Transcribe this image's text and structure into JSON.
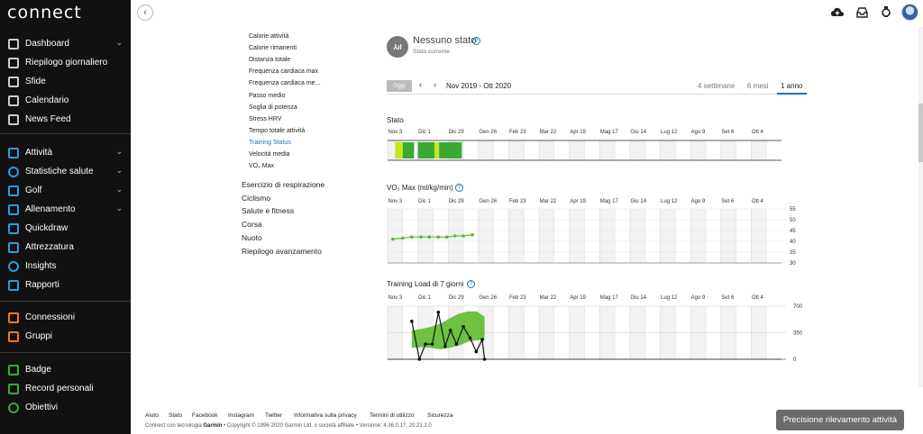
{
  "app": {
    "logo": "connect"
  },
  "sidebar": {
    "items": [
      {
        "label": "Dashboard",
        "icon": "dashboard-icon",
        "color": "#cccccc",
        "chevron": true
      },
      {
        "label": "Riepilogo giornaliero",
        "icon": "summary-icon",
        "color": "#cccccc",
        "chevron": false
      },
      {
        "label": "Sfide",
        "icon": "challenges-icon",
        "color": "#cccccc",
        "chevron": false
      },
      {
        "label": "Calendario",
        "icon": "calendar-icon",
        "color": "#cccccc",
        "chevron": false
      },
      {
        "label": "News Feed",
        "icon": "newsfeed-icon",
        "color": "#cccccc",
        "chevron": false
      },
      {
        "label": "Attività",
        "icon": "activities-icon",
        "color": "#2d9bd9",
        "chevron": true
      },
      {
        "label": "Statistiche salute",
        "icon": "heart-icon",
        "color": "#2d9bd9",
        "chevron": true
      },
      {
        "label": "Golf",
        "icon": "golf-icon",
        "color": "#2d9bd9",
        "chevron": true
      },
      {
        "label": "Allenamento",
        "icon": "training-icon",
        "color": "#2d9bd9",
        "chevron": true
      },
      {
        "label": "Quickdraw",
        "icon": "quickdraw-icon",
        "color": "#2d9bd9",
        "chevron": false
      },
      {
        "label": "Attrezzatura",
        "icon": "gear-icon",
        "color": "#2d9bd9",
        "chevron": false
      },
      {
        "label": "Insights",
        "icon": "insights-icon",
        "color": "#2d9bd9",
        "chevron": false
      },
      {
        "label": "Rapporti",
        "icon": "reports-icon",
        "color": "#2d9bd9",
        "chevron": false
      },
      {
        "label": "Connessioni",
        "icon": "connections-icon",
        "color": "#f07a1e",
        "chevron": false
      },
      {
        "label": "Gruppi",
        "icon": "groups-icon",
        "color": "#f07a1e",
        "chevron": false
      },
      {
        "label": "Badge",
        "icon": "badge-icon",
        "color": "#3aaa35",
        "chevron": false
      },
      {
        "label": "Record personali",
        "icon": "trophy-icon",
        "color": "#3aaa35",
        "chevron": false
      },
      {
        "label": "Obiettivi",
        "icon": "goals-icon",
        "color": "#3aaa35",
        "chevron": false
      }
    ]
  },
  "reports": {
    "subitems": [
      "Calorie attività",
      "Calorie rimanenti",
      "Distanza totale",
      "Frequenza cardiaca max",
      "Frequenza cardiaca me...",
      "Passo medio",
      "Soglia di potenza",
      "Stress HRV",
      "Tempo totale attività",
      "Training Status",
      "Velocità media",
      "VO₂ Max"
    ],
    "active_subitem": "Training Status",
    "categories": [
      "Esercizio di respirazione",
      "Ciclismo",
      "Salute e fitness",
      "Corsa",
      "Nuoto",
      "Riepilogo avanzamento"
    ]
  },
  "status": {
    "icon_text": "⅄ıl",
    "title": "Nessuno stato",
    "subtitle": "Stato corrente"
  },
  "date_controls": {
    "today_label": "Oggi",
    "prev": "‹",
    "next": "›",
    "range_label": "Nov 2019 - Ott 2020",
    "ranges": [
      "4 settimane",
      "6 mesi",
      "1 anno"
    ],
    "active_range": "1 anno"
  },
  "months": [
    "Nov 3",
    "Dic 1",
    "Dic 29",
    "Gen 26",
    "Feb 23",
    "Mar 22",
    "Apr 19",
    "Mag 17",
    "Giu 14",
    "Lug 12",
    "Ago 9",
    "Set 6",
    "Ott 4"
  ],
  "chart_data": [
    {
      "type": "bar",
      "title": "Stato",
      "x": [
        "Nov 3",
        "Dic 1",
        "Dic 29",
        "Gen 26",
        "Feb 23",
        "Mar 22",
        "Apr 19",
        "Mag 17",
        "Giu 14",
        "Lug 12",
        "Ago 9",
        "Set 6",
        "Ott 4"
      ],
      "segments": [
        {
          "start_week": 1,
          "end_week": 2,
          "color": "#c8e619"
        },
        {
          "start_week": 2,
          "end_week": 3.5,
          "color": "#3aaa35"
        },
        {
          "start_week": 4,
          "end_week": 6.2,
          "color": "#3aaa35"
        },
        {
          "start_week": 6.2,
          "end_week": 6.8,
          "color": "#c8e619"
        },
        {
          "start_week": 6.8,
          "end_week": 9.8,
          "color": "#3aaa35"
        }
      ],
      "grid": true
    },
    {
      "type": "line",
      "title": "VO₂ Max (ml/kg/min)",
      "x": [
        "Nov 3",
        "Dic 1",
        "Dic 29",
        "Gen 26",
        "Feb 23",
        "Mar 22",
        "Apr 19",
        "Mag 17",
        "Giu 14",
        "Lug 12",
        "Ago 9",
        "Set 6",
        "Ott 4"
      ],
      "yticks": [
        55,
        50,
        45,
        40,
        35,
        30
      ],
      "ylim": [
        30,
        55
      ],
      "series": [
        {
          "weeks": [
            0.7,
            2.0,
            3.2,
            4.4,
            5.5,
            6.7,
            7.8,
            8.9,
            10.0,
            11.2
          ],
          "values": [
            41,
            41.5,
            42,
            42,
            42,
            42,
            42,
            42.5,
            42.5,
            43
          ],
          "color": "#5dbb2f"
        }
      ],
      "grid": true
    },
    {
      "type": "line",
      "title": "Training Load di 7 giorni",
      "x": [
        "Nov 3",
        "Dic 1",
        "Dic 29",
        "Gen 26",
        "Feb 23",
        "Mar 22",
        "Apr 19",
        "Mag 17",
        "Giu 14",
        "Lug 12",
        "Ago 9",
        "Set 6",
        "Ott 4"
      ],
      "yticks": [
        700,
        350,
        0
      ],
      "ylim": [
        0,
        700
      ],
      "band": {
        "weeks": [
          3.2,
          4.5,
          5.8,
          7.0,
          8.2,
          9.4,
          10.6,
          11.8,
          12.8,
          12.8,
          11.8,
          10.6,
          9.4,
          8.2,
          7.0,
          5.8,
          4.5,
          3.2
        ],
        "values": [
          380,
          400,
          430,
          470,
          540,
          600,
          630,
          630,
          560,
          260,
          250,
          230,
          180,
          150,
          130,
          150,
          160,
          150
        ],
        "color": "#5dbb2f"
      },
      "series": [
        {
          "weeks": [
            3.2,
            4.2,
            5.0,
            5.9,
            6.7,
            7.6,
            8.3,
            9.1,
            10.0,
            10.9,
            11.7,
            12.5,
            12.8
          ],
          "values": [
            500,
            0,
            200,
            200,
            620,
            170,
            380,
            200,
            430,
            280,
            100,
            260,
            0
          ],
          "color": "#111111"
        }
      ],
      "grid": true
    }
  ],
  "footer": {
    "links": [
      "Aiuto",
      "Stato",
      "Facebook",
      "Instagram",
      "Twitter",
      "Informativa sulla privacy",
      "Termini di utilizzo",
      "Sicurezza"
    ],
    "copy_pre": "Connect con tecnologia",
    "copy_brand": "Garmin",
    "copy_post": "• Copyright © 1996-2020 Garmin Ltd. o società affiliate • Versione: 4.36.0.17, 20.21.2.0",
    "accuracy_button": "Precisione rilevamento attività"
  },
  "help_glyph": "?"
}
